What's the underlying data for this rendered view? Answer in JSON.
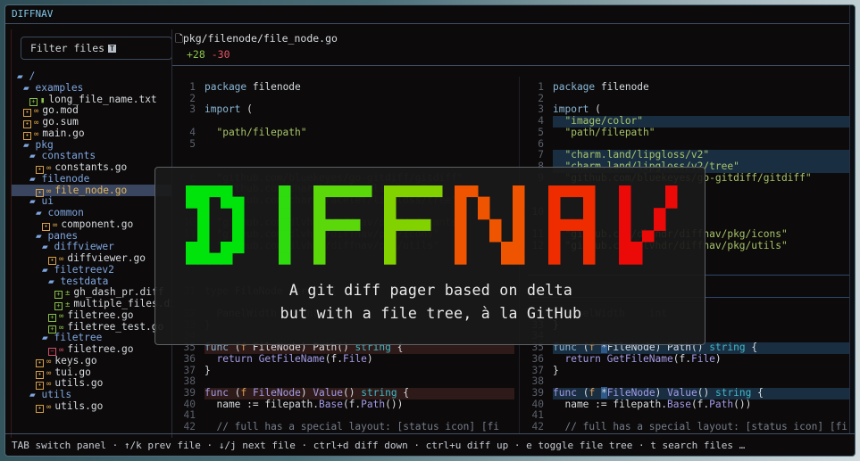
{
  "app_title": "DIFFNAV",
  "sidebar": {
    "filter_label": "Filter files",
    "filter_key": "T",
    "tree": [
      {
        "label": "/",
        "depth": 0,
        "type": "folder"
      },
      {
        "label": "examples",
        "depth": 1,
        "type": "folder"
      },
      {
        "label": "long_file_name.txt",
        "depth": 2,
        "type": "file",
        "status": "added",
        "icon": "text-file-icon"
      },
      {
        "label": "go.mod",
        "depth": 1,
        "type": "file",
        "status": "modified",
        "icon": "go-icon"
      },
      {
        "label": "go.sum",
        "depth": 1,
        "type": "file",
        "status": "modified",
        "icon": "go-icon"
      },
      {
        "label": "main.go",
        "depth": 1,
        "type": "file",
        "status": "modified",
        "icon": "go-icon"
      },
      {
        "label": "pkg",
        "depth": 1,
        "type": "folder"
      },
      {
        "label": "constants",
        "depth": 2,
        "type": "folder"
      },
      {
        "label": "constants.go",
        "depth": 3,
        "type": "file",
        "status": "modified",
        "icon": "go-icon"
      },
      {
        "label": "filenode",
        "depth": 2,
        "type": "folder"
      },
      {
        "label": "file_node.go",
        "depth": 3,
        "type": "file",
        "status": "modified",
        "icon": "go-icon",
        "selected": true
      },
      {
        "label": "ui",
        "depth": 2,
        "type": "folder"
      },
      {
        "label": "common",
        "depth": 3,
        "type": "folder"
      },
      {
        "label": "component.go",
        "depth": 4,
        "type": "file",
        "status": "modified",
        "icon": "go-icon"
      },
      {
        "label": "panes",
        "depth": 3,
        "type": "folder"
      },
      {
        "label": "diffviewer",
        "depth": 4,
        "type": "folder"
      },
      {
        "label": "diffviewer.go",
        "depth": 5,
        "type": "file",
        "status": "modified",
        "icon": "go-icon"
      },
      {
        "label": "filetreev2",
        "depth": 4,
        "type": "folder"
      },
      {
        "label": "testdata",
        "depth": 5,
        "type": "folder"
      },
      {
        "label": "gh_dash_pr.diff",
        "depth": 6,
        "type": "file",
        "status": "added",
        "icon": "diff-icon"
      },
      {
        "label": "multiple_files.diff",
        "depth": 6,
        "type": "file",
        "status": "added",
        "icon": "diff-icon"
      },
      {
        "label": "filetree.go",
        "depth": 5,
        "type": "file",
        "status": "added",
        "icon": "go-icon"
      },
      {
        "label": "filetree_test.go",
        "depth": 5,
        "type": "file",
        "status": "added",
        "icon": "go-icon"
      },
      {
        "label": "filetree",
        "depth": 4,
        "type": "folder"
      },
      {
        "label": "filetree.go",
        "depth": 5,
        "type": "file",
        "status": "deleted",
        "icon": "go-icon"
      },
      {
        "label": "keys.go",
        "depth": 3,
        "type": "file",
        "status": "modified",
        "icon": "go-icon"
      },
      {
        "label": "tui.go",
        "depth": 3,
        "type": "file",
        "status": "modified",
        "icon": "go-icon"
      },
      {
        "label": "utils.go",
        "depth": 3,
        "type": "file",
        "status": "modified",
        "icon": "go-icon"
      },
      {
        "label": "utils",
        "depth": 2,
        "type": "folder"
      },
      {
        "label": "utils.go",
        "depth": 3,
        "type": "file",
        "status": "modified",
        "icon": "go-icon"
      }
    ]
  },
  "diff": {
    "path": "pkg/filenode/file_node.go",
    "additions": "+28",
    "deletions": "-30",
    "left": [
      {
        "i": 0,
        "n": "1",
        "s": [
          [
            "kw",
            "package"
          ],
          [
            "pl",
            " filenode"
          ]
        ]
      },
      {
        "i": 1,
        "n": "2",
        "s": []
      },
      {
        "i": 2,
        "n": "3",
        "s": [
          [
            "kw",
            "import"
          ],
          [
            "pl",
            " ("
          ]
        ]
      },
      {
        "i": 4,
        "n": "4",
        "s": [
          [
            "str",
            "  \"path/filepath\""
          ]
        ]
      },
      {
        "i": 5,
        "n": "5",
        "s": []
      },
      {
        "i": 8,
        "n": "6",
        "s": [
          [
            "str",
            "  \"github.com/bluekeyes/go-gitdiff/gitdiff\""
          ]
        ],
        "faded": true
      },
      {
        "i": 9,
        "n": "7",
        "s": [
          [
            "str",
            "  \"github.com/charmbracelet/lipgloss\""
          ]
        ],
        "faded": true
      },
      {
        "i": 10,
        "n": "8",
        "s": [
          [
            "str",
            "  \"github.com/charmbracelet/lipgloss/tree\""
          ]
        ],
        "faded": true
      },
      {
        "i": 12,
        "n": "10",
        "s": [
          [
            "str",
            "  \"github.com/dlvhdr/diffnav/pkg/constants\""
          ]
        ],
        "faded": true
      },
      {
        "i": 13,
        "n": "11",
        "s": [
          [
            "str",
            "  \"github.com/dlvhdr/diffnav/pkg/icons\""
          ]
        ],
        "faded": true
      },
      {
        "i": 14,
        "n": "12",
        "s": [
          [
            "str",
            "  \"github.com/dlvhdr/diffnav/pkg/utils\""
          ]
        ],
        "faded": true
      },
      {
        "i": 18,
        "n": "31",
        "s": [
          [
            "kw",
            "type"
          ],
          [
            "pl",
            " FileNode struct {"
          ]
        ],
        "faded": true
      },
      {
        "i": 20,
        "n": "32",
        "s": [
          [
            "pl",
            "  PanelWidth    int"
          ]
        ],
        "faded": true
      },
      {
        "i": 21,
        "n": "33",
        "s": [
          [
            "pl",
            "}"
          ]
        ],
        "faded": true
      },
      {
        "i": 22,
        "n": "34",
        "s": [],
        "faded": true
      },
      {
        "i": 23,
        "n": "35",
        "s": [
          [
            "kw",
            "func"
          ],
          [
            "pl",
            " ("
          ],
          [
            "rcv",
            "f"
          ],
          [
            "pl",
            " FileNode) Path() "
          ],
          [
            "ty",
            "string"
          ],
          [
            "pl",
            " {"
          ]
        ],
        "hl": "del"
      },
      {
        "i": 24,
        "n": "36",
        "s": [
          [
            "fn",
            "  return"
          ],
          [
            "pl",
            " "
          ],
          [
            "fn",
            "GetFileName"
          ],
          [
            "pl",
            "(f."
          ],
          [
            "fn",
            "File"
          ],
          [
            "pl",
            ")"
          ]
        ]
      },
      {
        "i": 25,
        "n": "37",
        "s": [
          [
            "pl",
            "}"
          ]
        ]
      },
      {
        "i": 26,
        "n": "38",
        "s": []
      },
      {
        "i": 27,
        "n": "39",
        "s": [
          [
            "fn",
            "func"
          ],
          [
            "pl",
            " ("
          ],
          [
            "rcv",
            "f"
          ],
          [
            "pl",
            " "
          ],
          [
            "fn",
            "FileNode"
          ],
          [
            "pl",
            ") "
          ],
          [
            "fn",
            "Value"
          ],
          [
            "pl",
            "() "
          ],
          [
            "ty",
            "string"
          ],
          [
            "pl",
            " {"
          ]
        ],
        "hl": "del"
      },
      {
        "i": 28,
        "n": "40",
        "s": [
          [
            "pl",
            "  name := filepath."
          ],
          [
            "fn",
            "Base"
          ],
          [
            "pl",
            "(f."
          ],
          [
            "fn",
            "Path"
          ],
          [
            "pl",
            "())"
          ]
        ]
      },
      {
        "i": 29,
        "n": "41",
        "s": []
      },
      {
        "i": 30,
        "n": "42",
        "s": [
          [
            "cm",
            "  // full has a special layout: [status icon] [fi"
          ]
        ]
      }
    ],
    "right": [
      {
        "i": 0,
        "n": "1",
        "s": [
          [
            "kw",
            "package"
          ],
          [
            "pl",
            " filenode"
          ]
        ]
      },
      {
        "i": 1,
        "n": "2",
        "s": []
      },
      {
        "i": 2,
        "n": "3",
        "s": [
          [
            "kw",
            "import"
          ],
          [
            "pl",
            " ("
          ]
        ]
      },
      {
        "i": 3,
        "n": "4",
        "s": [
          [
            "str",
            "  \"image/color\""
          ]
        ],
        "hl": "add"
      },
      {
        "i": 4,
        "n": "5",
        "s": [
          [
            "str",
            "  \"path/filepath\""
          ]
        ]
      },
      {
        "i": 5,
        "n": "6",
        "s": []
      },
      {
        "i": 6,
        "n": "7",
        "s": [
          [
            "str",
            "  \"charm.land/lipgloss/v2\""
          ]
        ],
        "hl": "add"
      },
      {
        "i": 7,
        "n": "8",
        "s": [
          [
            "str",
            "  \"charm.land/lipgloss/v2/tree\""
          ]
        ],
        "hl": "add"
      },
      {
        "i": 8,
        "n": "9",
        "s": [
          [
            "str",
            "  \"github.com/bluekeyes/go-gitdiff/gitdiff\""
          ]
        ]
      },
      {
        "i": 11,
        "n": "10",
        "s": []
      },
      {
        "i": 13,
        "n": "11",
        "s": [
          [
            "str",
            "  \"github.com/dlvhdr/diffnav/pkg/icons\""
          ]
        ]
      },
      {
        "i": 14,
        "n": "12",
        "s": [
          [
            "str",
            "  \"github.com/dlvhdr/diffnav/pkg/utils\""
          ]
        ]
      },
      {
        "i": 20,
        "n": "32",
        "s": [
          [
            "pl",
            "  PanelWidth    int"
          ]
        ],
        "faded": true
      },
      {
        "i": 21,
        "n": "33",
        "s": [
          [
            "pl",
            "}"
          ]
        ]
      },
      {
        "i": 22,
        "n": "34",
        "s": []
      },
      {
        "i": 23,
        "n": "35",
        "s": [
          [
            "kw",
            "func"
          ],
          [
            "pl",
            " ("
          ],
          [
            "rcv",
            "f"
          ],
          [
            "pl",
            " "
          ],
          [
            "mark",
            "*"
          ],
          [
            "pl",
            "FileNode) Path() "
          ],
          [
            "ty",
            "string"
          ],
          [
            "pl",
            " {"
          ]
        ],
        "hl": "add"
      },
      {
        "i": 24,
        "n": "36",
        "s": [
          [
            "fn",
            "  return"
          ],
          [
            "pl",
            " "
          ],
          [
            "fn",
            "GetFileName"
          ],
          [
            "pl",
            "(f."
          ],
          [
            "fn",
            "File"
          ],
          [
            "pl",
            ")"
          ]
        ]
      },
      {
        "i": 25,
        "n": "37",
        "s": [
          [
            "pl",
            "}"
          ]
        ]
      },
      {
        "i": 26,
        "n": "38",
        "s": []
      },
      {
        "i": 27,
        "n": "39",
        "s": [
          [
            "fn",
            "func"
          ],
          [
            "pl",
            " ("
          ],
          [
            "rcv",
            "f"
          ],
          [
            "pl",
            " "
          ],
          [
            "mark",
            "*"
          ],
          [
            "fn",
            "FileNode"
          ],
          [
            "pl",
            ") "
          ],
          [
            "fn",
            "Value"
          ],
          [
            "pl",
            "() "
          ],
          [
            "ty",
            "string"
          ],
          [
            "pl",
            " {"
          ]
        ],
        "hl": "add"
      },
      {
        "i": 28,
        "n": "40",
        "s": [
          [
            "pl",
            "  name := filepath."
          ],
          [
            "fn",
            "Base"
          ],
          [
            "pl",
            "(f."
          ],
          [
            "fn",
            "Path"
          ],
          [
            "pl",
            "())"
          ]
        ]
      },
      {
        "i": 29,
        "n": "41",
        "s": []
      },
      {
        "i": 30,
        "n": "42",
        "s": [
          [
            "cm",
            "  // full has a special layout: [status icon] [fi"
          ]
        ]
      }
    ]
  },
  "splash": {
    "logo_letters": [
      "D",
      "I",
      "F",
      "F",
      "N",
      "A",
      "V"
    ],
    "logo_colors": [
      "#00e40c",
      "#2fdc0e",
      "#5ad80a",
      "#82d200",
      "#ef5500",
      "#ee2c00",
      "#ec0a08"
    ],
    "tagline_1": "A git diff pager based on delta",
    "tagline_2": "but with a file tree, à la GitHub"
  },
  "status_bar": "TAB switch panel · ↑/k prev file · ↓/j next file · ctrl+d diff down · ctrl+u diff up · e toggle file tree · t search files …"
}
